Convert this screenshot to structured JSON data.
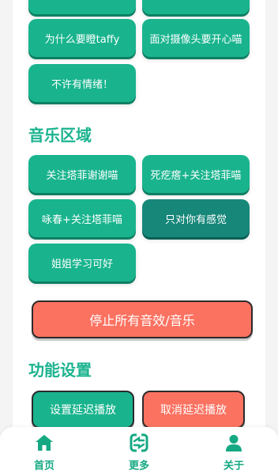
{
  "sound_buttons": {
    "cut_top_left": "",
    "cut_top_right": "",
    "why_taffy": "为什么要瞪taffy",
    "camera_smile": "面对摄像头要开心喵",
    "no_emotion": "不许有情绪！"
  },
  "music_section": {
    "title": "音乐区域",
    "buttons": {
      "follow_thanks": "关注塔菲谢谢喵",
      "dead_follow": "死疙瘩+关注塔菲喵",
      "yongchun_follow": "咏春+关注塔菲喵",
      "only_feel_you": "只对你有感觉",
      "sister_study": "姐姐学习可好"
    }
  },
  "stop_all_label": "停止所有音效/音乐",
  "function_section": {
    "title": "功能设置",
    "set_delay_label": "设置延迟播放",
    "cancel_delay_label": "取消延迟播放"
  },
  "bottom_nav": {
    "home": "首页",
    "more": "更多",
    "about": "关于"
  },
  "colors": {
    "accent": "#1bb38f",
    "button": "#19b48e",
    "button_selected": "#17877a",
    "danger": "#fb7261"
  },
  "icons": {
    "home": "home-icon",
    "more": "more-icon",
    "about": "user-icon"
  }
}
